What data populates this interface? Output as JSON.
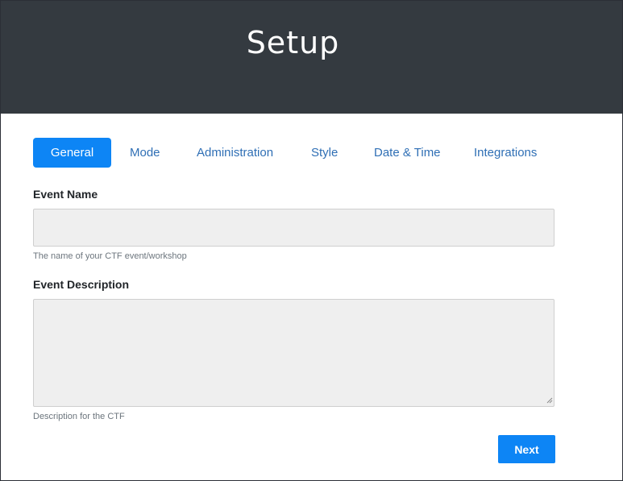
{
  "header": {
    "title": "Setup"
  },
  "tabs": [
    {
      "label": "General",
      "active": true
    },
    {
      "label": "Mode",
      "active": false
    },
    {
      "label": "Administration",
      "active": false
    },
    {
      "label": "Style",
      "active": false
    },
    {
      "label": "Date & Time",
      "active": false
    },
    {
      "label": "Integrations",
      "active": false
    }
  ],
  "form": {
    "event_name": {
      "label": "Event Name",
      "value": "",
      "help": "The name of your CTF event/workshop"
    },
    "event_description": {
      "label": "Event Description",
      "value": "",
      "help": "Description for the CTF"
    },
    "next_label": "Next"
  },
  "colors": {
    "header_bg": "#343a40",
    "accent": "#0d85f5",
    "tab_link": "#2f6fb5",
    "input_bg": "#efefef"
  },
  "icons": {
    "resize_grip": "resize-grip-icon"
  }
}
